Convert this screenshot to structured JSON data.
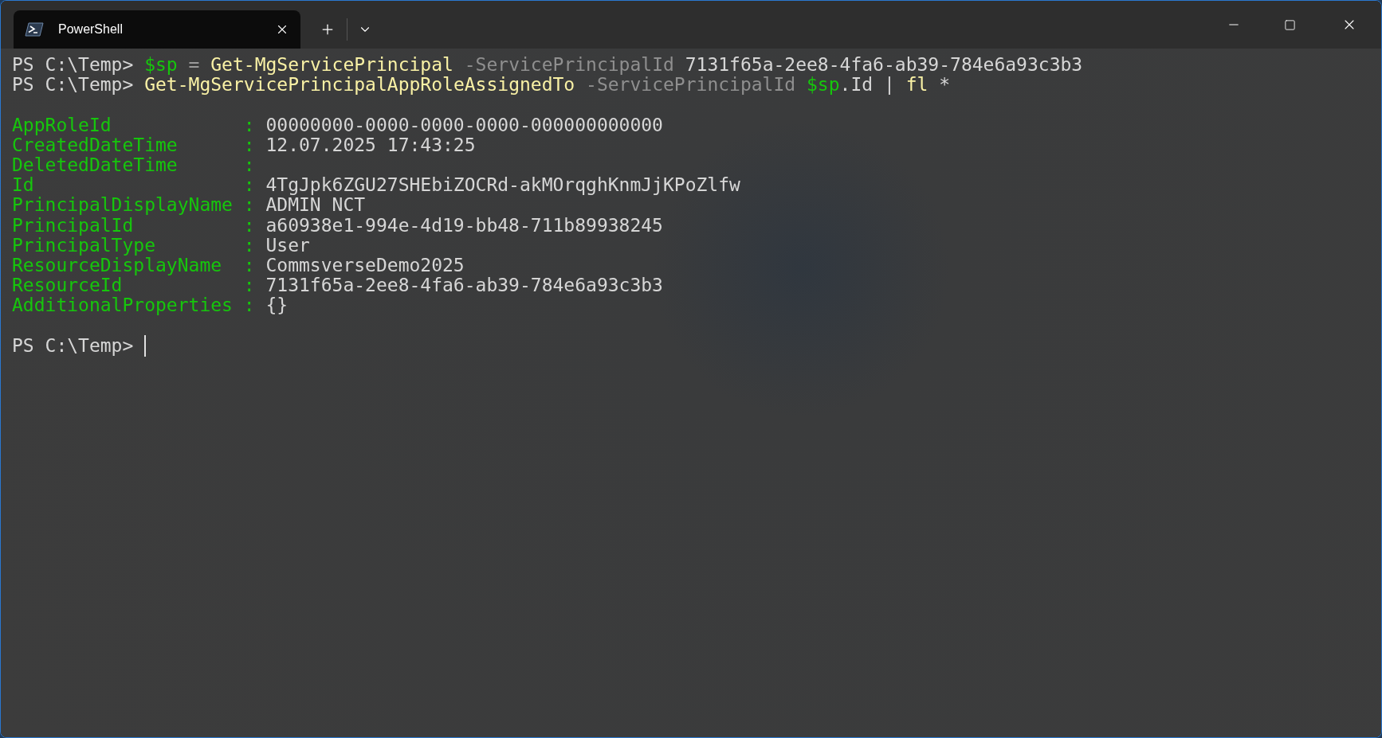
{
  "window": {
    "tab": {
      "title": "PowerShell",
      "selected": true
    }
  },
  "terminal": {
    "commands": [
      {
        "segments": [
          {
            "text": "PS C:\\Temp> ",
            "kind": "prompt"
          },
          {
            "text": "$sp",
            "kind": "variable"
          },
          {
            "text": " = ",
            "kind": "operator"
          },
          {
            "text": "Get-MgServicePrincipal",
            "kind": "command"
          },
          {
            "text": " -ServicePrincipalId",
            "kind": "parameter"
          },
          {
            "text": " 7131f65a-2ee8-4fa6-ab39-784e6a93c3b3",
            "kind": "argument"
          }
        ]
      },
      {
        "segments": [
          {
            "text": "PS C:\\Temp> ",
            "kind": "prompt"
          },
          {
            "text": "Get-MgServicePrincipalAppRoleAssignedTo",
            "kind": "command"
          },
          {
            "text": " -ServicePrincipalId",
            "kind": "parameter"
          },
          {
            "text": " $sp",
            "kind": "variable"
          },
          {
            "text": ".Id | ",
            "kind": "argument"
          },
          {
            "text": "fl",
            "kind": "command"
          },
          {
            "text": " *",
            "kind": "argument"
          }
        ]
      }
    ],
    "properties": [
      {
        "name": "AppRoleId",
        "separator": ":",
        "value": "00000000-0000-0000-0000-000000000000"
      },
      {
        "name": "CreatedDateTime",
        "separator": ":",
        "value": "12.07.2025 17:43:25"
      },
      {
        "name": "DeletedDateTime",
        "separator": ":"
      },
      {
        "name": "Id",
        "separator": ":",
        "value": "4TgJpk6ZGU27SHEbiZOCRd-akMOrqghKnmJjKPoZlfw"
      },
      {
        "name": "PrincipalDisplayName",
        "separator": ":",
        "value": "ADMIN NCT"
      },
      {
        "name": "PrincipalId",
        "separator": ":",
        "value": "a60938e1-994e-4d19-bb48-711b89938245"
      },
      {
        "name": "PrincipalType",
        "separator": ":",
        "value": "User"
      },
      {
        "name": "ResourceDisplayName",
        "separator": ":",
        "value": "CommsverseDemo2025"
      },
      {
        "name": "ResourceId",
        "separator": ":",
        "value": "7131f65a-2ee8-4fa6-ab39-784e6a93c3b3"
      },
      {
        "name": "AdditionalProperties",
        "separator": ":",
        "value": "{}"
      }
    ],
    "prompt": "PS C:\\Temp>"
  }
}
